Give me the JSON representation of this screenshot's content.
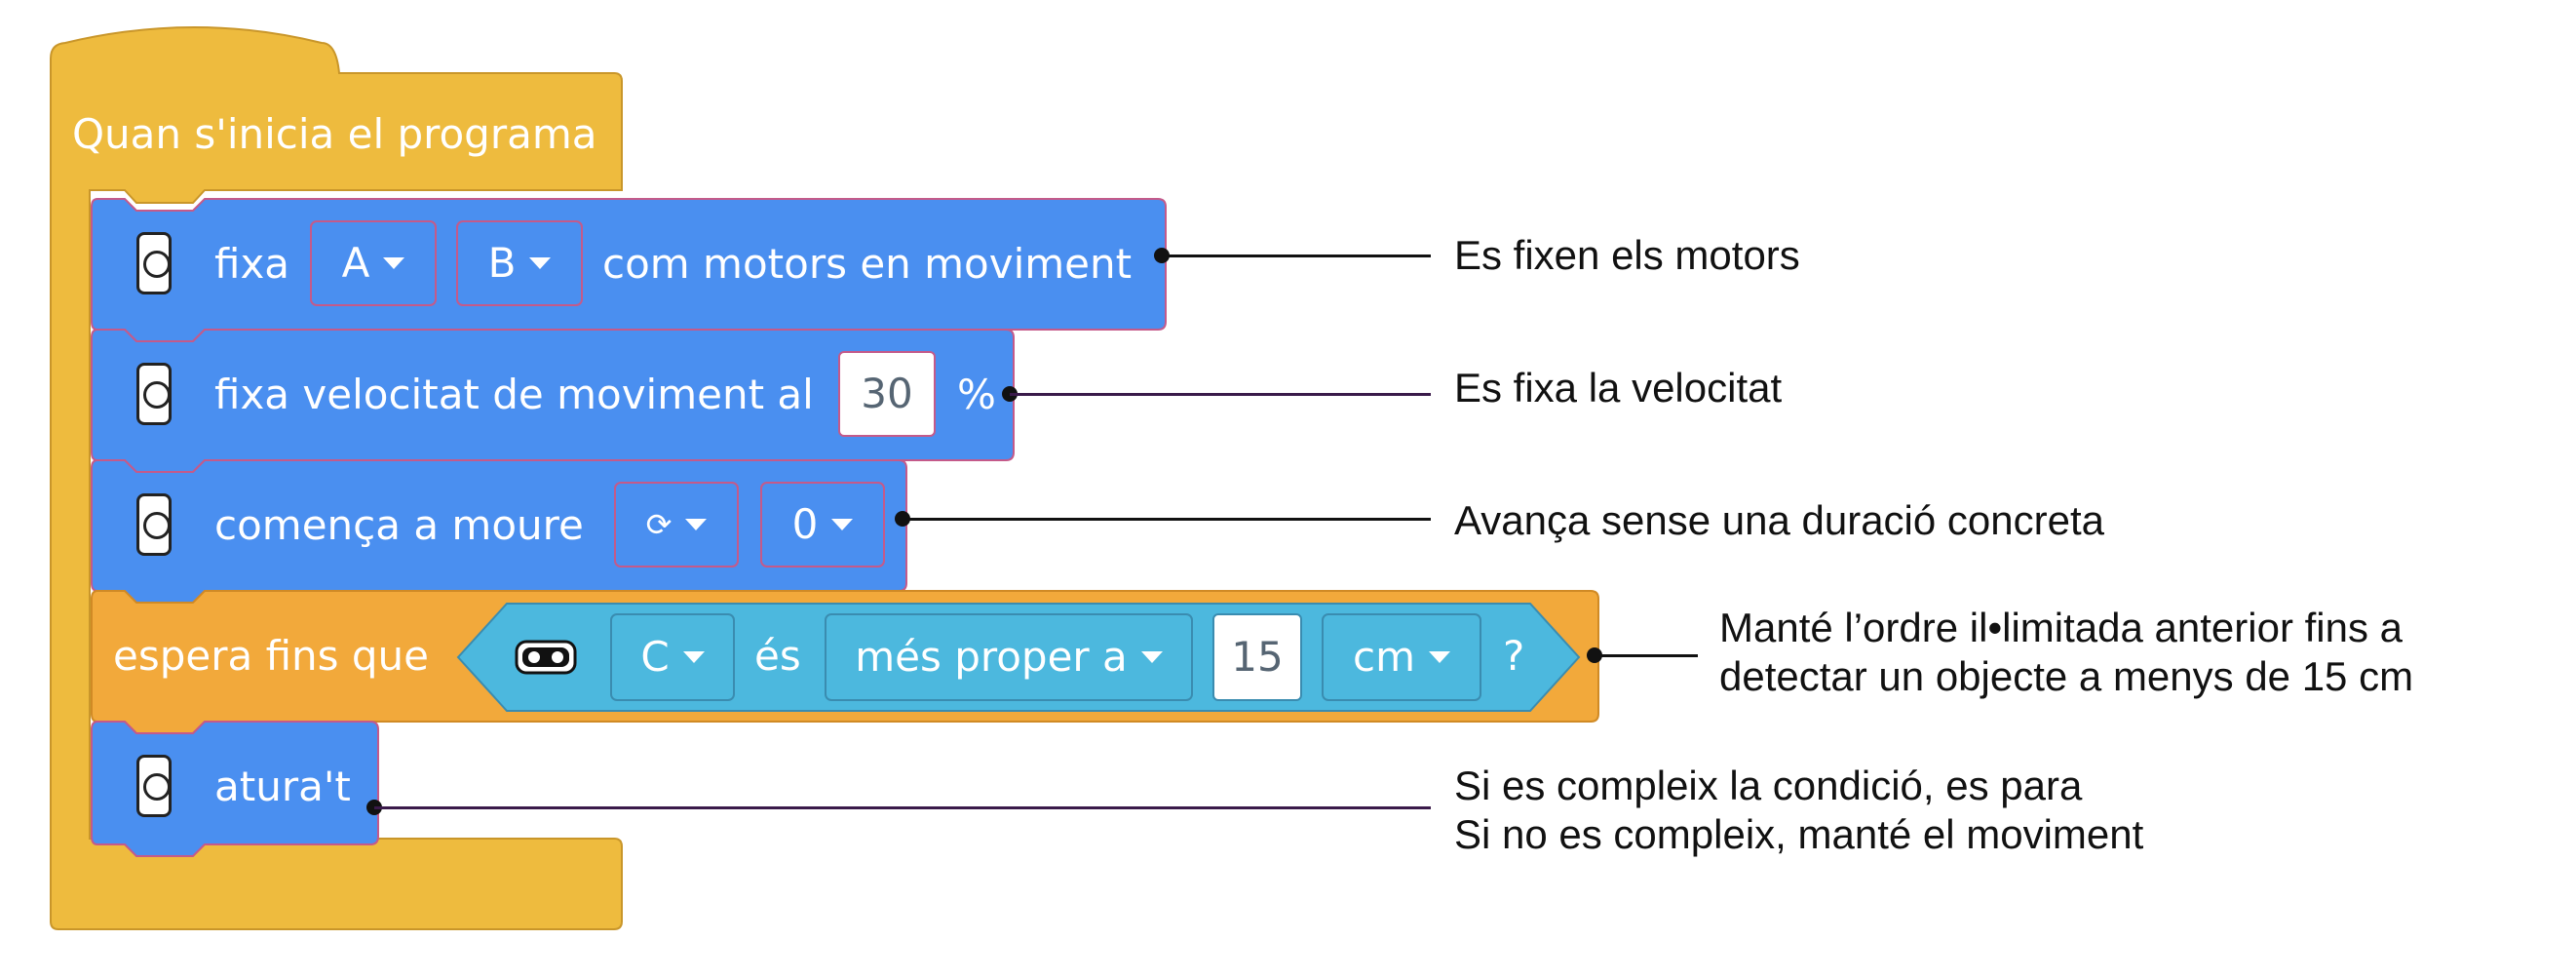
{
  "hat": {
    "label": "Quan s'inicia el programa"
  },
  "blocks": {
    "set_motors": {
      "label_pre": "fixa",
      "port_a": "A",
      "port_b": "B",
      "label_post": "com motors en moviment"
    },
    "set_speed": {
      "label_pre": "fixa velocitat de moviment al",
      "value": "30",
      "unit": "%"
    },
    "start_move": {
      "label": "comença a moure",
      "direction_icon": "⟳",
      "value": "0"
    },
    "wait_until": {
      "label": "espera fins que",
      "port": "C",
      "verb": "és",
      "comparison": "més proper a",
      "value": "15",
      "unit": "cm",
      "question": "?"
    },
    "stop": {
      "label": "atura't"
    }
  },
  "annotations": {
    "a1": "Es fixen els motors",
    "a2": "Es fixa la velocitat",
    "a3": "Avança sense una duració concreta",
    "a4_l1": "Manté l’ordre il•limitada anterior fins a",
    "a4_l2": "detectar un objecte a menys de 15 cm",
    "a5_l1": "Si es compleix la condició, es para",
    "a5_l2": "Si no es compleix, manté el moviment"
  },
  "colors": {
    "event": "#eebb3e",
    "motion": "#4a8ff0",
    "control": "#f2a93b",
    "sensor": "#4cb8de"
  },
  "icons": {
    "motor": "move-hub-icon",
    "sensor": "distance-sensor-icon"
  }
}
